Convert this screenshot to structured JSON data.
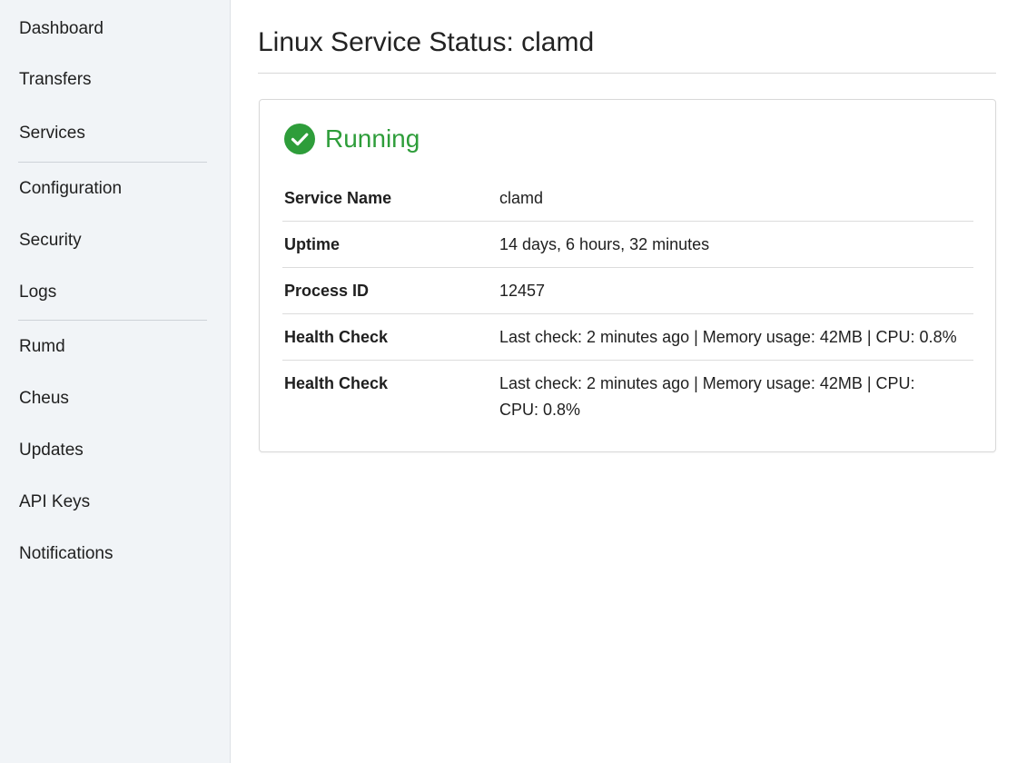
{
  "sidebar": {
    "items": [
      {
        "label": "Dashboard"
      },
      {
        "label": "Transfers"
      },
      {
        "label": "Services"
      },
      {
        "label": "Configuration"
      },
      {
        "label": "Security"
      },
      {
        "label": "Logs"
      },
      {
        "label": "Rumd"
      },
      {
        "label": "Cheus"
      },
      {
        "label": "Updates"
      },
      {
        "label": "API Keys"
      },
      {
        "label": "Notifications"
      }
    ]
  },
  "main": {
    "title": "Linux Service Status: clamd",
    "status": {
      "icon": "check-circle-icon",
      "text": "Running",
      "color": "#2e9d3a"
    },
    "rows": [
      {
        "label": "Service Name",
        "value": "clamd"
      },
      {
        "label": "Uptime",
        "value": "14 days, 6 hours, 32 minutes"
      },
      {
        "label": "Process ID",
        "value": "12457"
      },
      {
        "label": "Health Check",
        "value": "Last check: 2 minutes ago | Memory usage: 42MB | CPU: 0.8%"
      },
      {
        "label": "Health Check",
        "value": "Last check: 2 minutes ago | Memory usage: 42MB | CPU:"
      },
      {
        "label": "",
        "value": "CPU: 0.8%"
      }
    ]
  }
}
